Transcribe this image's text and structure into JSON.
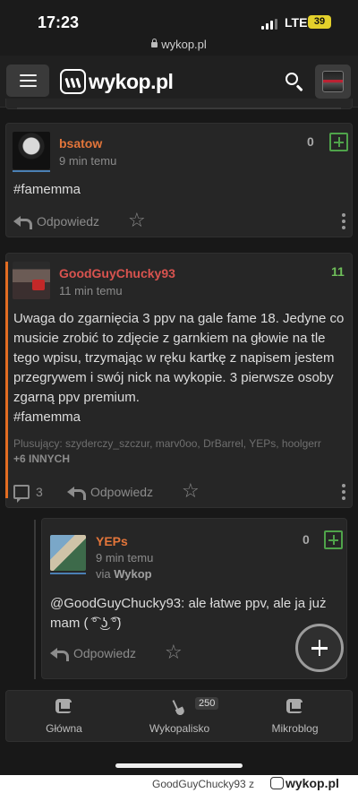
{
  "status_bar": {
    "time": "17:23",
    "network": "LTE",
    "battery": "39",
    "url": "wykop.pl"
  },
  "header": {
    "logo_text": "wykop.pl"
  },
  "posts": [
    {
      "author": "bsatow",
      "author_color": "#e3753a",
      "time": "9 min temu",
      "score": "0",
      "body": "#famemma",
      "reply_label": "Odpowiedz"
    },
    {
      "author": "GoodGuyChucky93",
      "author_color": "#d9534f",
      "time": "11 min temu",
      "score": "11",
      "score_color": "#6fbf5a",
      "body_line1": "Uwaga do zgarnięcia 3 ppv na gale fame 18. Jedyne co musicie zrobić to zdjęcie z garnkiem na głowie na tle tego wpisu, trzymając w ręku kartkę z napisem jestem przegrywem i swój nick na wykopie. 3 pierwsze osoby zgarną ppv premium.",
      "body_line2": "#famemma",
      "plusers_prefix": "Plusujący:",
      "plusers_list": "szyderczy_szczur, marv0oo, DrBarrel, YEPs, hoolgerr",
      "plusers_more": "+6 INNYCH",
      "comments_count": "3",
      "reply_label": "Odpowiedz"
    },
    {
      "author": "YEPs",
      "author_color": "#e3753a",
      "time": "9 min temu",
      "via_prefix": "via",
      "via_app": "Wykop",
      "score": "0",
      "body_mention": "@GoodGuyChucky93",
      "body_rest": ": ale łatwe ppv, ale ja już mam ( ͡° ͜ʖ ͡°)",
      "reply_label": "Odpowiedz"
    }
  ],
  "bottom_nav": {
    "items": [
      {
        "label": "Główna",
        "icon": "wykop-home-icon"
      },
      {
        "label": "Wykopalisko",
        "icon": "shovel-icon",
        "badge": "250"
      },
      {
        "label": "Mikroblog",
        "icon": "mikroblog-icon"
      }
    ]
  },
  "footer": {
    "text": "GoodGuyChucky93  z",
    "logo": "wykop.pl"
  }
}
